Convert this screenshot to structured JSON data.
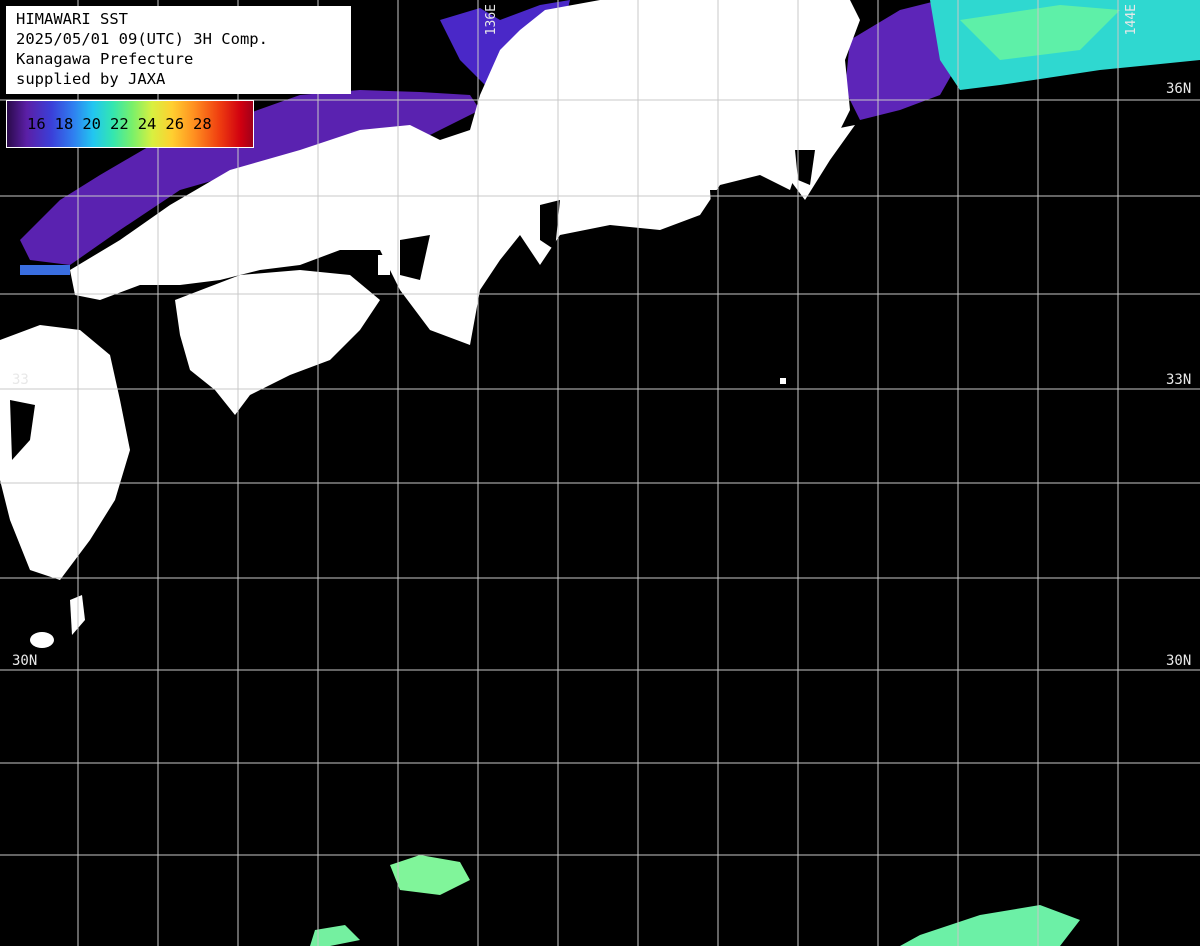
{
  "header": {
    "title": "HIMAWARI SST",
    "datetime": "2025/05/01 09(UTC) 3H Comp.",
    "organization": "Kanagawa Prefecture",
    "credit": "supplied by JAXA"
  },
  "legend": {
    "ticks": [
      "16",
      "18",
      "20",
      "22",
      "24",
      "26",
      "28"
    ]
  },
  "grid_labels": {
    "lat_36_right": "36N",
    "lat_33_right": "33N",
    "lat_33_left": "33",
    "lat_30_right": "30N",
    "lat_30_left": "30N",
    "lon_136": "136E",
    "lon_144": "144E"
  },
  "colors": {
    "ocean_missing": "#000000",
    "land": "#ffffff",
    "grid": "#c8c8c8",
    "sst_cool": "#5b1fa6",
    "sst_warm_patch": "#7af0a0"
  }
}
